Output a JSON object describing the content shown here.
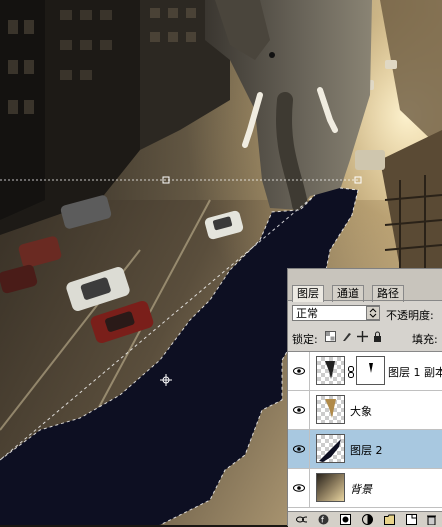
{
  "layers_panel": {
    "tabs": [
      {
        "label": "图层",
        "active": true
      },
      {
        "label": "通道",
        "active": false
      },
      {
        "label": "路径",
        "active": false
      }
    ],
    "blend_mode": "正常",
    "opacity_label": "不透明度:",
    "lock_label": "锁定:",
    "fill_label": "填充:",
    "layers": [
      {
        "name": "图层 1 副本",
        "visible": true,
        "selected": false
      },
      {
        "name": "大象",
        "visible": true,
        "selected": false
      },
      {
        "name": "图层 2",
        "visible": true,
        "selected": true
      },
      {
        "name": "背景",
        "visible": true,
        "selected": false
      }
    ]
  },
  "colors": {
    "selection_highlight": "#a8c8e0",
    "shadow_fill": "#0d0f22",
    "panel_bg": "#d6d3ce"
  }
}
